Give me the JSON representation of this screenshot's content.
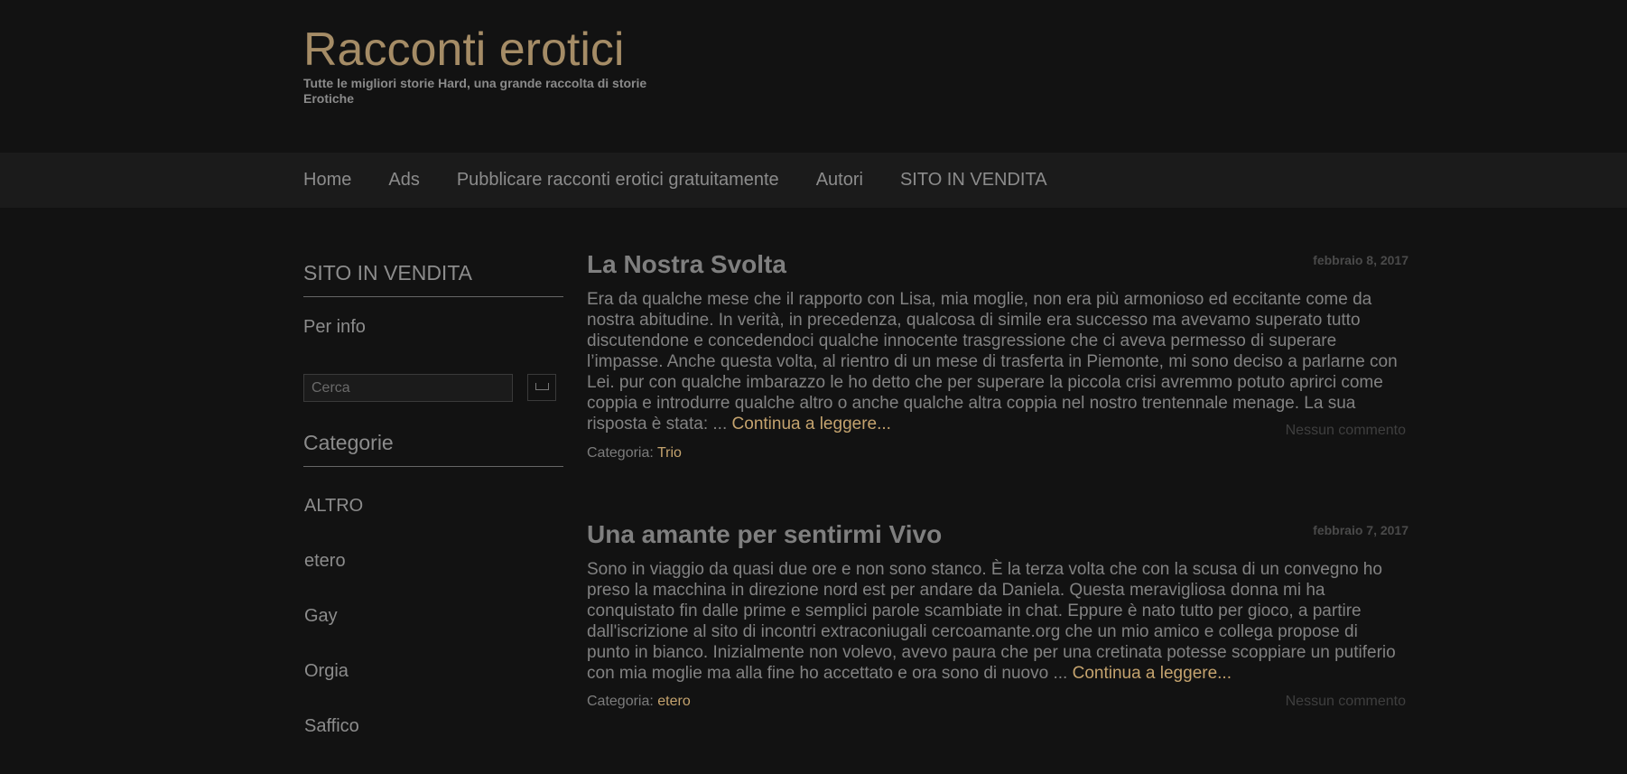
{
  "header": {
    "title": "Racconti erotici",
    "description": "Tutte le migliori storie Hard, una grande raccolta di storie Erotiche"
  },
  "nav": {
    "items": [
      "Home",
      "Ads",
      "Pubblicare racconti erotici gratuitamente",
      "Autori",
      "SITO IN VENDITA"
    ]
  },
  "sidebar": {
    "sale_title": "SITO IN VENDITA",
    "sale_text": "Per info",
    "search": {
      "placeholder": "Cerca"
    },
    "categories_title": "Categorie",
    "categories": [
      "ALTRO",
      "etero",
      "Gay",
      "Orgia",
      "Saffico"
    ]
  },
  "posts": [
    {
      "title": "La Nostra Svolta",
      "date": "febbraio 8, 2017",
      "excerpt": "Era da qualche mese che il rapporto con Lisa, mia moglie, non era più armonioso ed eccitante come da nostra abitudine. In verità, in precedenza, qualcosa di simile era successo ma avevamo superato tutto discutendone e concedendoci qualche innocente trasgressione che ci aveva permesso di superare l’impasse. Anche questa volta, al rientro di un mese di trasferta in Piemonte, mi sono deciso a parlarne con Lei. pur con qualche imbarazzo le ho detto che per superare la piccola crisi avremmo potuto aprirci come coppia e introdurre qualche altro o anche qualche altra coppia nel nostro trentennale menage. La sua risposta è stata: ...",
      "read_more": "Continua a leggere...",
      "category_label": "Categoria:",
      "category": "Trio",
      "comments": "Nessun commento"
    },
    {
      "title": "Una amante per sentirmi Vivo",
      "date": "febbraio 7, 2017",
      "excerpt": "Sono in viaggio da quasi due ore e non sono stanco. È la terza volta che con la scusa di un convegno ho preso la macchina in direzione nord est per andare da Daniela. Questa meravigliosa donna mi ha conquistato fin dalle prime e semplici parole scambiate in chat. Eppure è nato tutto per gioco, a partire dall'iscrizione al sito di incontri extraconiugali cercoamante.org che un mio amico e collega propose di punto in bianco. Inizialmente non volevo, avevo paura che per una cretinata potesse scoppiare un putiferio con mia moglie ma alla fine ho accettato e ora sono di nuovo ...",
      "read_more": "Continua a leggere...",
      "category_label": "Categoria:",
      "category": "etero",
      "comments": "Nessun commento"
    }
  ]
}
